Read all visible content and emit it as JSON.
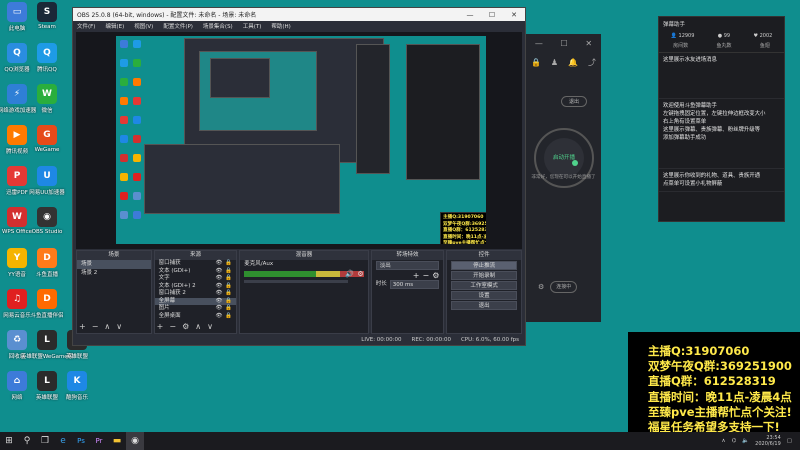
{
  "desktop": {
    "icons": [
      {
        "label": "此电脑",
        "color": "#3d7bd9",
        "glyph": "▭",
        "col": 0,
        "row": 0
      },
      {
        "label": "Steam",
        "color": "#1b2838",
        "glyph": "S",
        "col": 1,
        "row": 0
      },
      {
        "label": "QQ浏览器",
        "color": "#2a8de0",
        "glyph": "Q",
        "col": 0,
        "row": 1
      },
      {
        "label": "腾讯QQ",
        "color": "#1e9be6",
        "glyph": "Q",
        "col": 1,
        "row": 1
      },
      {
        "label": "网络游戏加速器",
        "color": "#2f7fd6",
        "glyph": "⚡",
        "col": 0,
        "row": 2
      },
      {
        "label": "微信",
        "color": "#2aae3d",
        "glyph": "W",
        "col": 1,
        "row": 2
      },
      {
        "label": "腾讯视频",
        "color": "#ff7a00",
        "glyph": "▶",
        "col": 0,
        "row": 3
      },
      {
        "label": "WeGame",
        "color": "#e64a19",
        "glyph": "G",
        "col": 1,
        "row": 3
      },
      {
        "label": "迅雷PDF",
        "color": "#e53935",
        "glyph": "P",
        "col": 0,
        "row": 4
      },
      {
        "label": "网易UU加速器",
        "color": "#1e88e5",
        "glyph": "U",
        "col": 1,
        "row": 4
      },
      {
        "label": "WPS Office",
        "color": "#d32f2f",
        "glyph": "W",
        "col": 0,
        "row": 5
      },
      {
        "label": "OBS Studio",
        "color": "#333333",
        "glyph": "◉",
        "col": 1,
        "row": 5
      },
      {
        "label": "YY语音",
        "color": "#f5b400",
        "glyph": "Y",
        "col": 0,
        "row": 6
      },
      {
        "label": "斗鱼直播",
        "color": "#ff7b1a",
        "glyph": "D",
        "col": 1,
        "row": 6
      },
      {
        "label": "网易云音乐",
        "color": "#e02020",
        "glyph": "♫",
        "col": 0,
        "row": 7
      },
      {
        "label": "斗鱼直播伴侣",
        "color": "#ff6a00",
        "glyph": "D",
        "col": 1,
        "row": 7
      },
      {
        "label": "回收站",
        "color": "#5a8fd0",
        "glyph": "♻",
        "col": 0,
        "row": 8
      },
      {
        "label": "英雄联盟WeGame版",
        "color": "#2b2b2b",
        "glyph": "L",
        "col": 1,
        "row": 8
      },
      {
        "label": "英雄联盟",
        "color": "#2b2b2b",
        "glyph": "L",
        "col": 2,
        "row": 8
      },
      {
        "label": "网络",
        "color": "#3d7bd9",
        "glyph": "⌂",
        "col": 0,
        "row": 9
      },
      {
        "label": "英雄联盟",
        "color": "#2b2b2b",
        "glyph": "L",
        "col": 1,
        "row": 9
      },
      {
        "label": "酷狗音乐",
        "color": "#1e88e5",
        "glyph": "K",
        "col": 2,
        "row": 9
      }
    ]
  },
  "obs": {
    "title": "OBS 25.0.8 (64-bit, windows) - 配置文件: 未命名 - 场景: 未命名",
    "menu": [
      "文件(F)",
      "编辑(E)",
      "视图(V)",
      "配置文件(P)",
      "场景集合(S)",
      "工具(T)",
      "帮助(H)"
    ],
    "docks": {
      "scenes": {
        "title": "场景",
        "items": [
          "场景",
          "场景 2"
        ]
      },
      "sources": {
        "title": "来源",
        "items": [
          "窗口捕获",
          "文本 (GDI+)",
          "文字",
          "文本 (GDI+) 2",
          "窗口捕获 2",
          "全屏幕",
          "图片",
          "全屏桌面"
        ]
      },
      "mixer": {
        "title": "混音器",
        "track": "麦克风/Aux"
      },
      "transitions": {
        "title": "转场特效",
        "type": "淡出",
        "duration_label": "时长",
        "duration": "300 ms"
      },
      "controls": {
        "title": "控件",
        "buttons": [
          "停止推流",
          "开始录制",
          "工作室模式",
          "设置",
          "退出"
        ]
      }
    },
    "status": {
      "live": "LIVE: 00:00:00",
      "rec": "REC: 00:00:00",
      "cpu": "CPU: 6.0%, 60.00 fps"
    }
  },
  "assistant": {
    "stop_label": "退出",
    "start_label": "启动开播",
    "hint": "非常好，您现在可以开始直播了",
    "bottom_label": "设置",
    "status_label": "连接中"
  },
  "chat": {
    "title": "弹幕助手",
    "stats": [
      "12909",
      "99",
      "2002"
    ],
    "tabs": [
      "房间数",
      "鱼丸数",
      "鱼翅"
    ],
    "messages": [
      "这里展示水友进场消息",
      "欢迎使用斗鱼弹幕助手\n左键拖拽固定位置，左键拉伸边框改变大小\n右上角有设置菜单\n这里展示弹幕、贵族弹幕、粉丝牌升级等\n添加弹幕助手成功",
      "这里展示你收到的礼物、道具、贵族开通\n点菜单可设置小礼物屏蔽"
    ]
  },
  "overlay": {
    "lines": [
      "主播Q:31907060",
      "双梦午夜Q群:369251900",
      "直播Q群：612528319",
      "直播时间：晚11点-凌晨4点",
      "至臻pve主播帮忙点个关注!",
      "福星任务希望多支持一下!"
    ]
  },
  "taskbar": {
    "items": [
      "windows-icon",
      "search-icon",
      "taskview-icon",
      "edge-icon",
      "photoshop-icon",
      "premiere-icon",
      "explorer-icon",
      "obs-icon"
    ],
    "time": "23:54",
    "date": "2020/6/19"
  },
  "colors": {
    "desktop": "#0f8e8e",
    "overlay_text": "#ffe94a",
    "obs_bg": "#2b2e38"
  }
}
